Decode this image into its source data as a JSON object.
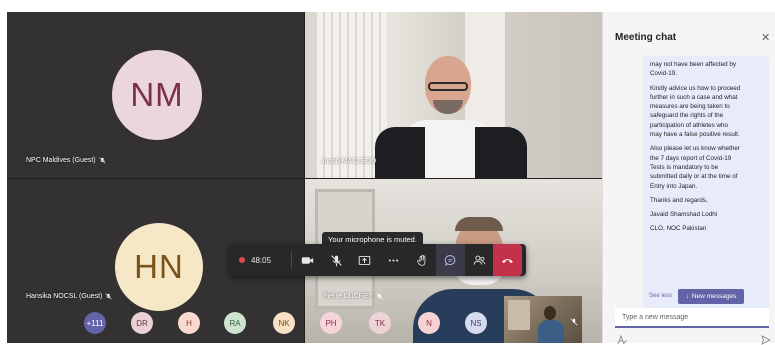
{
  "participants": {
    "top_left": {
      "initials": "NM",
      "name": "NPC Maldives (Guest)",
      "avatar_bg": "#ecd6dd"
    },
    "top_right": {
      "name": "Jacob MACLEOD"
    },
    "bottom_left": {
      "initials": "HN",
      "name": "Hansika NOCSL (Guest)",
      "avatar_bg": "#f6e8c7"
    },
    "bottom_right": {
      "name": "Pierre DUCREY"
    }
  },
  "toolbar": {
    "timer": "48:05",
    "tooltip": "Your microphone is muted.",
    "hangup_color": "#c4314b"
  },
  "roster": [
    {
      "label": "+111",
      "bg": "#6264a7",
      "fg": "#ffffff"
    },
    {
      "label": "DR",
      "bg": "#e9d1d4",
      "fg": "#6a3b45"
    },
    {
      "label": "H",
      "bg": "#f9d9d0",
      "fg": "#8a3c2c"
    },
    {
      "label": "RA",
      "bg": "#cfe4d0",
      "fg": "#2f5f34"
    },
    {
      "label": "NK",
      "bg": "#f8e0c4",
      "fg": "#7a4a1a"
    },
    {
      "label": "PH",
      "bg": "#f7d4da",
      "fg": "#8a2f44"
    },
    {
      "label": "TK",
      "bg": "#efd2d6",
      "fg": "#7a3440"
    },
    {
      "label": "N",
      "bg": "#f7d1d4",
      "fg": "#8a2f38"
    },
    {
      "label": "NS",
      "bg": "#d7dbef",
      "fg": "#3a4172"
    }
  ],
  "chat": {
    "title": "Meeting chat",
    "paragraphs": [
      "may not have been affected by\nCovid-19.",
      "Kindly advice us how to proceed\nfurther in such a case and what\nmeasures are being taken to\nsafeguard the rights of the\nparticipation of athletes who\nmay have a false positive result.",
      "Also please let us know whether\nthe 7 days report of Covid-19\nTests is mandatory to be\nsubmitted daily or at the time of\nEntry into Japan.",
      "Thanks and regards,",
      "Javaid Shamshad Lodhi",
      "CLO, NOC Pakistan"
    ],
    "see_less": "See less",
    "new_messages": "New messages",
    "compose_placeholder": "Type a new message",
    "accent": "#6264a7"
  }
}
